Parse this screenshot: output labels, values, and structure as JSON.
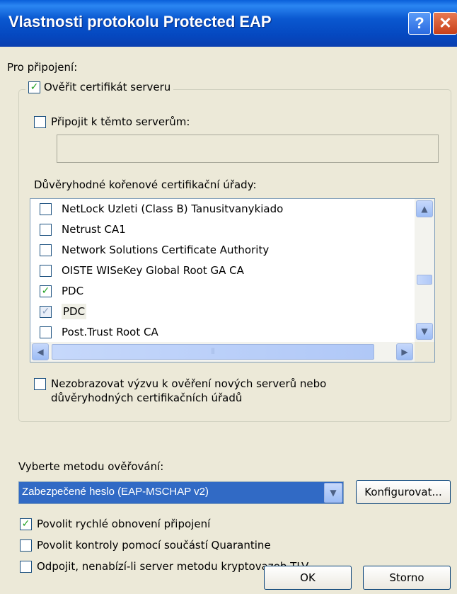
{
  "window": {
    "title": "Vlastnosti protokolu Protected EAP",
    "help_label": "?",
    "close_label": "✕"
  },
  "connection_label": "Pro připojení:",
  "verify_cert": {
    "label": "Ověřit certifikát serveru",
    "checked": true
  },
  "connect_servers": {
    "label": "Připojit k těmto serverům:",
    "checked": false,
    "value": ""
  },
  "trusted_ca_label": "Důvěryhodné kořenové certifikační úřady:",
  "ca_list": [
    {
      "label": "NetLock Uzleti (Class B) Tanusitvanykiado",
      "checked": false
    },
    {
      "label": "Netrust CA1",
      "checked": false
    },
    {
      "label": "Network Solutions Certificate Authority",
      "checked": false
    },
    {
      "label": "OISTE WISeKey Global Root GA CA",
      "checked": false
    },
    {
      "label": "PDC",
      "checked": true
    },
    {
      "label": "PDC",
      "checked": true,
      "grayed": true
    },
    {
      "label": "Post.Trust Root CA",
      "checked": false
    }
  ],
  "scroll_icons": {
    "up": "▲",
    "down": "▼",
    "left": "◀",
    "right": "▶",
    "grip": "⦀"
  },
  "no_prompt": {
    "label_line1": "Nezobrazovat výzvu k ověření nových serverů nebo",
    "label_line2": "důvěryhodných certifikačních úřadů",
    "checked": false
  },
  "auth_method_label": "Vyberte metodu ověřování:",
  "auth_method": {
    "selected": "Zabezpečené heslo (EAP-MSCHAP v2)",
    "dropdown_icon": "▼"
  },
  "configure_label": "Konfigurovat...",
  "options": [
    {
      "label": "Povolit rychlé obnovení připojení",
      "checked": true
    },
    {
      "label": "Povolit kontroly pomocí součástí Quarantine",
      "checked": false
    },
    {
      "label": "Odpojit, nenabízí-li server metodu kryptovazeb TLV",
      "checked": false
    }
  ],
  "ok_label": "OK",
  "cancel_label": "Storno",
  "check_mark": "✓",
  "colors": {
    "titlebar": "#0a58d0",
    "dialog_bg": "#ece9d8",
    "selection": "#316ac5",
    "check": "#21a121"
  }
}
